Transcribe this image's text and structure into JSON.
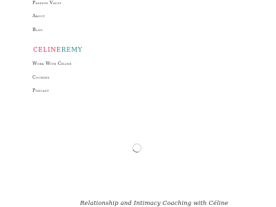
{
  "nav": {
    "passion_vault": "Passion Vault",
    "about": "About",
    "blog": "Blog",
    "work_with": "Work With Céline",
    "courses": "Courses",
    "podcast": "Podcast"
  },
  "brand": {
    "first": "CELINE",
    "last": "REMY"
  },
  "hero": {
    "tagline": "Relationship and Intimacy Coaching with Céline"
  },
  "colors": {
    "brand_first": "#d62f5a",
    "brand_last": "#1f8d93",
    "text": "#333333"
  },
  "icons": {
    "loading": "loading-spinner-icon"
  }
}
